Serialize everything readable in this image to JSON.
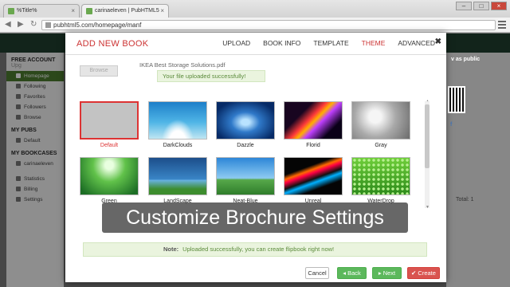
{
  "browser": {
    "tabs": [
      {
        "label": "%Title%"
      },
      {
        "label": "carinaeleven | PubHTML5"
      }
    ],
    "url": "pubhtml5.com/homepage/manf"
  },
  "site": {
    "sidebar": {
      "free_account": "FREE ACCOUNT",
      "upgrade": "Upg",
      "nav": [
        "Homepage",
        "Following",
        "Favorites",
        "Followers",
        "Browse"
      ],
      "my_pubs": "MY PUBS",
      "pubs": [
        "Default"
      ],
      "my_bookcases": "MY BOOKCASES",
      "bookcases": [
        "carinaeleven"
      ],
      "bottom": [
        "Statistics",
        "Billing",
        "Settings"
      ]
    },
    "share_text": "v as public",
    "social": "f",
    "total": "Total: 1"
  },
  "modal": {
    "title": "ADD NEW BOOK",
    "tabs": [
      "UPLOAD",
      "BOOK INFO",
      "TEMPLATE",
      "THEME",
      "ADVANCED"
    ],
    "active_tab": "THEME",
    "close": "✖",
    "browse_label": "Browse",
    "file_name": "IKEA Best Storage Solutions.pdf",
    "upload_status": "Your file uploaded successfully!",
    "themes": [
      {
        "name": "Default",
        "selected": true
      },
      {
        "name": "DarkClouds"
      },
      {
        "name": "Dazzle"
      },
      {
        "name": "Florid"
      },
      {
        "name": "Gray"
      },
      {
        "name": "Green"
      },
      {
        "name": "LandScape"
      },
      {
        "name": "Neat-Blue"
      },
      {
        "name": "Unreal"
      },
      {
        "name": "WaterDrop"
      }
    ],
    "caption": "Customize Brochure Settings",
    "note_label": "Note:",
    "note_text": "Uploaded successfully, you can create flipbook right now!",
    "buttons": {
      "cancel": "Cancel",
      "back": "◂ Back",
      "next": "▸ Next",
      "create": "✔ Create"
    }
  },
  "colors": {
    "accent_red": "#cc3333",
    "success_green": "#5cb85c",
    "danger_red": "#d9534f",
    "site_green": "#4c7d2f"
  }
}
